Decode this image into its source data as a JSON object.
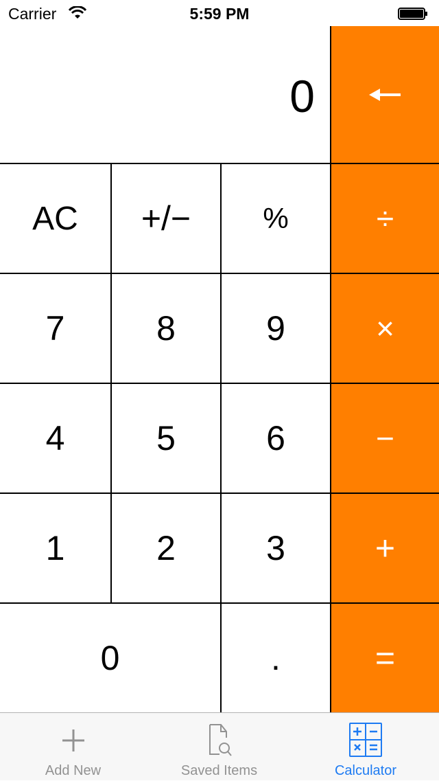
{
  "status_bar": {
    "carrier": "Carrier",
    "time": "5:59 PM",
    "wifi_icon": "wifi-icon",
    "battery_icon": "battery-full-icon"
  },
  "display": {
    "value": "0"
  },
  "keys": {
    "backspace": "←",
    "ac": "AC",
    "plus_minus": "+/−",
    "percent": "%",
    "divide": "÷",
    "seven": "7",
    "eight": "8",
    "nine": "9",
    "multiply": "×",
    "four": "4",
    "five": "5",
    "six": "6",
    "subtract": "−",
    "one": "1",
    "two": "2",
    "three": "3",
    "add": "+",
    "zero": "0",
    "decimal": ".",
    "equals": "="
  },
  "colors": {
    "operator_bg": "#FF7F00",
    "active_tab": "#1E7BF2",
    "inactive_tab": "#929292"
  },
  "tabbar": {
    "tabs": [
      {
        "label": "Add New",
        "icon": "plus-icon",
        "active": false
      },
      {
        "label": "Saved Items",
        "icon": "document-search-icon",
        "active": false
      },
      {
        "label": "Calculator",
        "icon": "calculator-icon",
        "active": true
      }
    ]
  }
}
